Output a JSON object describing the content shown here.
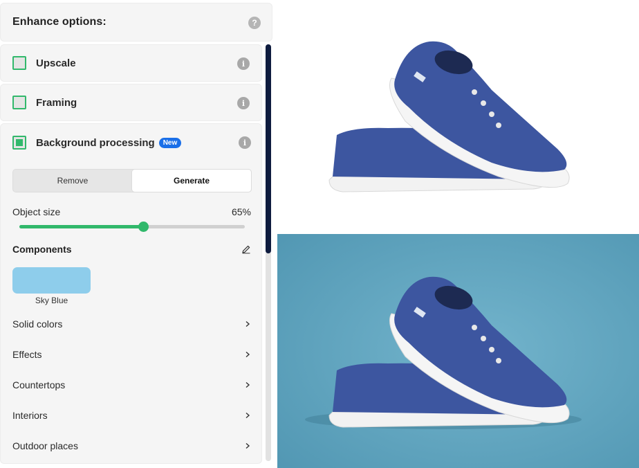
{
  "panel": {
    "title": "Enhance options:",
    "help_glyph": "?",
    "options": [
      {
        "label": "Upscale",
        "checked": false
      },
      {
        "label": "Framing",
        "checked": false
      },
      {
        "label": "Background processing",
        "checked": true,
        "badge": "New"
      }
    ],
    "info_glyph": "i",
    "mode_buttons": [
      {
        "label": "Remove",
        "active": false
      },
      {
        "label": "Generate",
        "active": true
      }
    ],
    "object_size": {
      "label": "Object size",
      "value_text": "65%",
      "value": 0.55
    },
    "components": {
      "label": "Components",
      "selected_swatch": {
        "name": "Sky Blue",
        "color": "#8ecdeb"
      }
    },
    "categories": [
      "Solid colors",
      "Effects",
      "Countertops",
      "Interiors",
      "Outdoor places"
    ]
  },
  "colors": {
    "accent": "#31b86b",
    "badge": "#1a6fe8",
    "scroll_thumb": "#0f1c3f",
    "generated_bg": "#5da3bf",
    "shoe": "#3d56a0"
  },
  "images": {
    "top": {
      "name": "shoe-original-white-background"
    },
    "bottom": {
      "name": "shoe-generated-blue-background"
    }
  }
}
